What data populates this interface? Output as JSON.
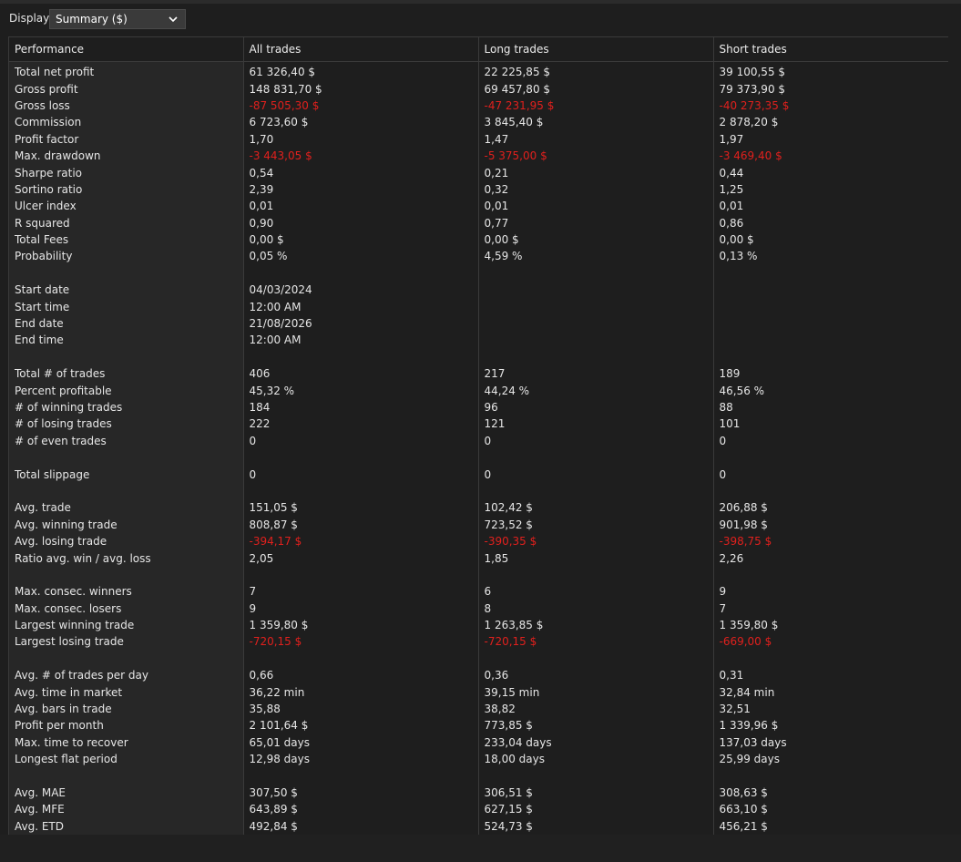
{
  "toolbar": {
    "display_label": "Display",
    "display_value": "Summary ($)"
  },
  "table": {
    "headers": [
      "Performance",
      "All trades",
      "Long trades",
      "Short trades"
    ],
    "rows": [
      {
        "label": "Total net profit",
        "values": [
          "61 326,40 $",
          "22 225,85 $",
          "39 100,55 $"
        ],
        "neg": [
          false,
          false,
          false
        ]
      },
      {
        "label": "Gross profit",
        "values": [
          "148 831,70 $",
          "69 457,80 $",
          "79 373,90 $"
        ],
        "neg": [
          false,
          false,
          false
        ]
      },
      {
        "label": "Gross loss",
        "values": [
          "-87 505,30 $",
          "-47 231,95 $",
          "-40 273,35 $"
        ],
        "neg": [
          true,
          true,
          true
        ]
      },
      {
        "label": "Commission",
        "values": [
          "6 723,60 $",
          "3 845,40 $",
          "2 878,20 $"
        ],
        "neg": [
          false,
          false,
          false
        ]
      },
      {
        "label": "Profit factor",
        "values": [
          "1,70",
          "1,47",
          "1,97"
        ],
        "neg": [
          false,
          false,
          false
        ]
      },
      {
        "label": "Max. drawdown",
        "values": [
          "-3 443,05 $",
          "-5 375,00 $",
          "-3 469,40 $"
        ],
        "neg": [
          true,
          true,
          true
        ]
      },
      {
        "label": "Sharpe ratio",
        "values": [
          "0,54",
          "0,21",
          "0,44"
        ],
        "neg": [
          false,
          false,
          false
        ]
      },
      {
        "label": "Sortino ratio",
        "values": [
          "2,39",
          "0,32",
          "1,25"
        ],
        "neg": [
          false,
          false,
          false
        ]
      },
      {
        "label": "Ulcer index",
        "values": [
          "0,01",
          "0,01",
          "0,01"
        ],
        "neg": [
          false,
          false,
          false
        ]
      },
      {
        "label": "R squared",
        "values": [
          "0,90",
          "0,77",
          "0,86"
        ],
        "neg": [
          false,
          false,
          false
        ]
      },
      {
        "label": "Total Fees",
        "values": [
          "0,00 $",
          "0,00 $",
          "0,00 $"
        ],
        "neg": [
          false,
          false,
          false
        ]
      },
      {
        "label": "Probability",
        "values": [
          "0,05 %",
          "4,59 %",
          "0,13 %"
        ],
        "neg": [
          false,
          false,
          false
        ]
      },
      {
        "label": "",
        "values": [
          "",
          "",
          ""
        ],
        "neg": [
          false,
          false,
          false
        ]
      },
      {
        "label": "Start date",
        "values": [
          "04/03/2024",
          "",
          ""
        ],
        "neg": [
          false,
          false,
          false
        ]
      },
      {
        "label": "Start time",
        "values": [
          "12:00 AM",
          "",
          ""
        ],
        "neg": [
          false,
          false,
          false
        ]
      },
      {
        "label": "End date",
        "values": [
          "21/08/2026",
          "",
          ""
        ],
        "neg": [
          false,
          false,
          false
        ]
      },
      {
        "label": "End time",
        "values": [
          "12:00 AM",
          "",
          ""
        ],
        "neg": [
          false,
          false,
          false
        ]
      },
      {
        "label": "",
        "values": [
          "",
          "",
          ""
        ],
        "neg": [
          false,
          false,
          false
        ]
      },
      {
        "label": "Total # of trades",
        "values": [
          "406",
          "217",
          "189"
        ],
        "neg": [
          false,
          false,
          false
        ]
      },
      {
        "label": "Percent profitable",
        "values": [
          "45,32 %",
          "44,24 %",
          "46,56 %"
        ],
        "neg": [
          false,
          false,
          false
        ]
      },
      {
        "label": "# of winning trades",
        "values": [
          "184",
          "96",
          "88"
        ],
        "neg": [
          false,
          false,
          false
        ]
      },
      {
        "label": "# of losing trades",
        "values": [
          "222",
          "121",
          "101"
        ],
        "neg": [
          false,
          false,
          false
        ]
      },
      {
        "label": "# of even trades",
        "values": [
          "0",
          "0",
          "0"
        ],
        "neg": [
          false,
          false,
          false
        ]
      },
      {
        "label": "",
        "values": [
          "",
          "",
          ""
        ],
        "neg": [
          false,
          false,
          false
        ]
      },
      {
        "label": "Total slippage",
        "values": [
          "0",
          "0",
          "0"
        ],
        "neg": [
          false,
          false,
          false
        ]
      },
      {
        "label": "",
        "values": [
          "",
          "",
          ""
        ],
        "neg": [
          false,
          false,
          false
        ]
      },
      {
        "label": "Avg. trade",
        "values": [
          "151,05 $",
          "102,42 $",
          "206,88 $"
        ],
        "neg": [
          false,
          false,
          false
        ]
      },
      {
        "label": "Avg. winning trade",
        "values": [
          "808,87 $",
          "723,52 $",
          "901,98 $"
        ],
        "neg": [
          false,
          false,
          false
        ]
      },
      {
        "label": "Avg. losing trade",
        "values": [
          "-394,17 $",
          "-390,35 $",
          "-398,75 $"
        ],
        "neg": [
          true,
          true,
          true
        ]
      },
      {
        "label": "Ratio avg. win / avg. loss",
        "values": [
          "2,05",
          "1,85",
          "2,26"
        ],
        "neg": [
          false,
          false,
          false
        ]
      },
      {
        "label": "",
        "values": [
          "",
          "",
          ""
        ],
        "neg": [
          false,
          false,
          false
        ]
      },
      {
        "label": "Max. consec. winners",
        "values": [
          "7",
          "6",
          "9"
        ],
        "neg": [
          false,
          false,
          false
        ]
      },
      {
        "label": "Max. consec. losers",
        "values": [
          "9",
          "8",
          "7"
        ],
        "neg": [
          false,
          false,
          false
        ]
      },
      {
        "label": "Largest winning trade",
        "values": [
          "1 359,80 $",
          "1 263,85 $",
          "1 359,80 $"
        ],
        "neg": [
          false,
          false,
          false
        ]
      },
      {
        "label": "Largest losing trade",
        "values": [
          "-720,15 $",
          "-720,15 $",
          "-669,00 $"
        ],
        "neg": [
          true,
          true,
          true
        ]
      },
      {
        "label": "",
        "values": [
          "",
          "",
          ""
        ],
        "neg": [
          false,
          false,
          false
        ]
      },
      {
        "label": "Avg. # of trades per day",
        "values": [
          "0,66",
          "0,36",
          "0,31"
        ],
        "neg": [
          false,
          false,
          false
        ]
      },
      {
        "label": "Avg. time in market",
        "values": [
          "36,22 min",
          "39,15 min",
          "32,84 min"
        ],
        "neg": [
          false,
          false,
          false
        ]
      },
      {
        "label": "Avg. bars in trade",
        "values": [
          "35,88",
          "38,82",
          "32,51"
        ],
        "neg": [
          false,
          false,
          false
        ]
      },
      {
        "label": "Profit per month",
        "values": [
          "2 101,64 $",
          "773,85 $",
          "1 339,96 $"
        ],
        "neg": [
          false,
          false,
          false
        ]
      },
      {
        "label": "Max. time to recover",
        "values": [
          "65,01 days",
          "233,04 days",
          "137,03 days"
        ],
        "neg": [
          false,
          false,
          false
        ]
      },
      {
        "label": "Longest flat period",
        "values": [
          "12,98 days",
          "18,00 days",
          "25,99 days"
        ],
        "neg": [
          false,
          false,
          false
        ]
      },
      {
        "label": "",
        "values": [
          "",
          "",
          ""
        ],
        "neg": [
          false,
          false,
          false
        ]
      },
      {
        "label": "Avg. MAE",
        "values": [
          "307,50 $",
          "306,51 $",
          "308,63 $"
        ],
        "neg": [
          false,
          false,
          false
        ]
      },
      {
        "label": "Avg. MFE",
        "values": [
          "643,89 $",
          "627,15 $",
          "663,10 $"
        ],
        "neg": [
          false,
          false,
          false
        ]
      },
      {
        "label": "Avg. ETD",
        "values": [
          "492,84 $",
          "524,73 $",
          "456,21 $"
        ],
        "neg": [
          false,
          false,
          false
        ]
      }
    ]
  },
  "colors": {
    "background": "#1e1e1e",
    "label_column": "#272727",
    "negative": "#e0201d",
    "text": "#e6e6e6",
    "grid": "#3a3a3a"
  },
  "icons": {
    "dropdown": "chevron-down-icon"
  }
}
